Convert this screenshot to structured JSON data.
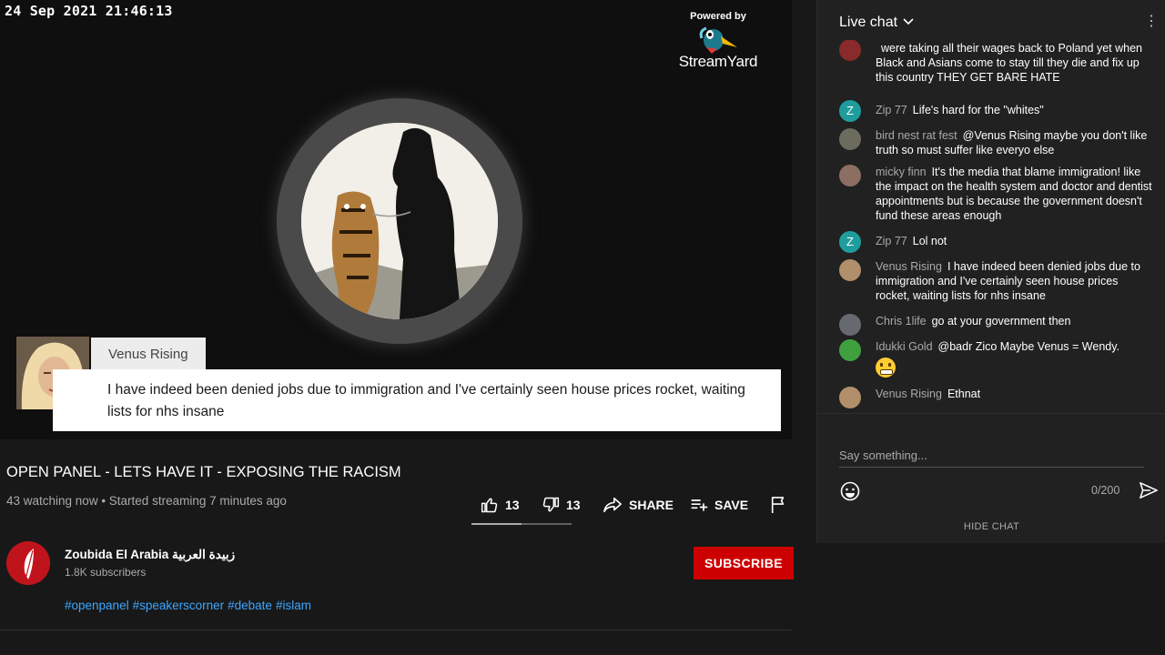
{
  "video": {
    "timestamp": "24 Sep 2021 21:46:13",
    "powered_by": "Powered by",
    "brand": "StreamYard",
    "caption": {
      "name": "Venus Rising",
      "text": "I have indeed been denied jobs due to immigration and I've certainly seen house prices rocket, waiting lists for nhs insane"
    }
  },
  "info": {
    "title": "OPEN PANEL - LETS HAVE IT - EXPOSING THE RACISM",
    "meta": "43 watching now • Started streaming 7 minutes ago",
    "likes": "13",
    "dislikes": "13",
    "like_ratio": 0.5,
    "share_label": "SHARE",
    "save_label": "SAVE"
  },
  "channel": {
    "name": "Zoubida El Arabia زبيدة العربية",
    "subscribers": "1.8K subscribers",
    "subscribe_label": "SUBSCRIBE",
    "hashtags": [
      "#openpanel",
      "#speakerscorner",
      "#debate",
      "#islam"
    ]
  },
  "chat": {
    "title": "Live chat",
    "messages": [
      {
        "author": "",
        "text": "were taking all their wages back to Poland yet when Black and Asians come to stay till they die and fix up this country THEY GET BARE HATE",
        "avatar_letter": "",
        "avatar_color": "#8a2a2a"
      },
      {
        "author": "Zip 77",
        "text": "Life's hard for the \"whites\"",
        "avatar_letter": "Z",
        "avatar_color": "#1f9d9d"
      },
      {
        "author": "bird nest rat fest",
        "text": "@Venus Rising maybe you don't like truth so must suffer like everyo else",
        "avatar_letter": "",
        "avatar_color": "#6b6b5e"
      },
      {
        "author": "micky finn",
        "text": "It's the media that blame immigration! like the impact on the health system and doctor and dentist appointments but is because the government doesn't fund these areas enough",
        "avatar_letter": "",
        "avatar_color": "#8d6e63"
      },
      {
        "author": "Zip 77",
        "text": "Lol not",
        "avatar_letter": "Z",
        "avatar_color": "#1f9d9d"
      },
      {
        "author": "Venus Rising",
        "text": "I have indeed been denied jobs due to immigration and I've certainly seen house prices rocket, waiting lists for nhs insane",
        "avatar_letter": "",
        "avatar_color": "#b08f6a"
      },
      {
        "author": "Chris 1life",
        "text": "go at your government then",
        "avatar_letter": "",
        "avatar_color": "#666a70"
      },
      {
        "author": "Idukki Gold",
        "text": "@badr Zico Maybe Venus = Wendy.",
        "avatar_letter": "",
        "avatar_color": "#3fa03f"
      },
      {
        "author": "Venus Rising",
        "text": "Ethnat",
        "avatar_letter": "",
        "avatar_color": "#b08f6a"
      }
    ],
    "input_placeholder": "Say something...",
    "counter": "0/200",
    "hide_label": "HIDE CHAT"
  }
}
